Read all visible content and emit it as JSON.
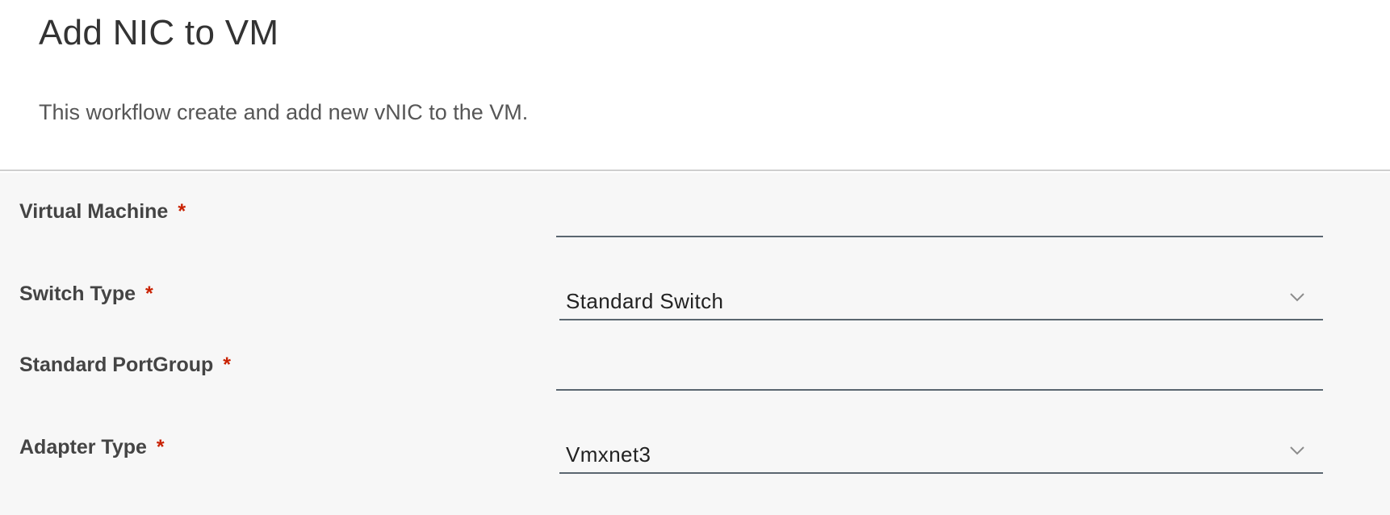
{
  "header": {
    "title": "Add NIC to VM",
    "description": "This workflow create and add new vNIC to the VM."
  },
  "form": {
    "virtual_machine": {
      "label": "Virtual Machine",
      "required_mark": "*",
      "value": ""
    },
    "switch_type": {
      "label": "Switch Type",
      "required_mark": "*",
      "selected": "Standard Switch",
      "icon": "chevron-down-icon"
    },
    "standard_portgroup": {
      "label": "Standard PortGroup",
      "required_mark": "*",
      "value": ""
    },
    "adapter_type": {
      "label": "Adapter Type",
      "required_mark": "*",
      "selected": "Vmxnet3",
      "icon": "chevron-down-icon"
    }
  },
  "colors": {
    "required": "#c92100",
    "form_background": "#f7f7f7",
    "field_underline": "#5a6670"
  }
}
